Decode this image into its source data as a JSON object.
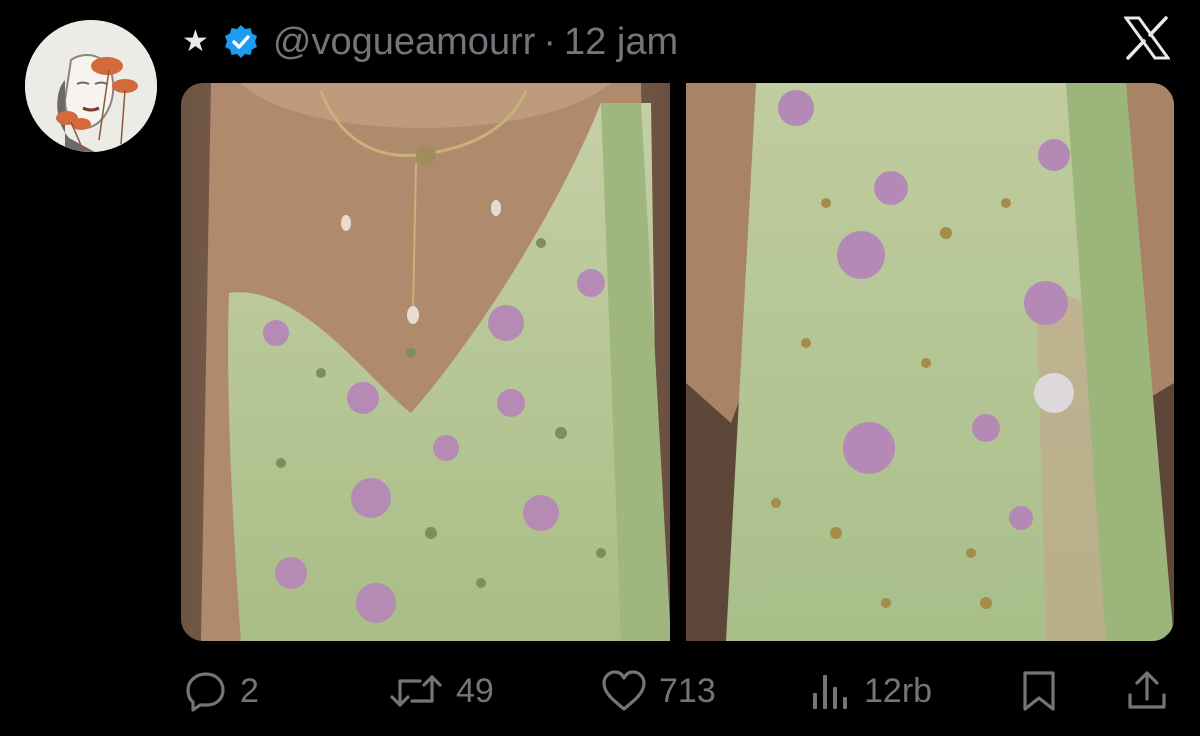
{
  "post": {
    "handle": "@vogueamourr",
    "separator": "·",
    "time": "12 jam"
  },
  "icons": {
    "star": "★",
    "verified": "verified-badge-icon",
    "logo": "x-logo-icon"
  },
  "colors": {
    "background": "#000000",
    "muted": "#71767b",
    "verified": "#1d9bf0",
    "dress_green": "#b7c99a",
    "skin": "#a07c62"
  },
  "actions": {
    "replies": "2",
    "reposts": "49",
    "likes": "713",
    "views": "12rb"
  }
}
